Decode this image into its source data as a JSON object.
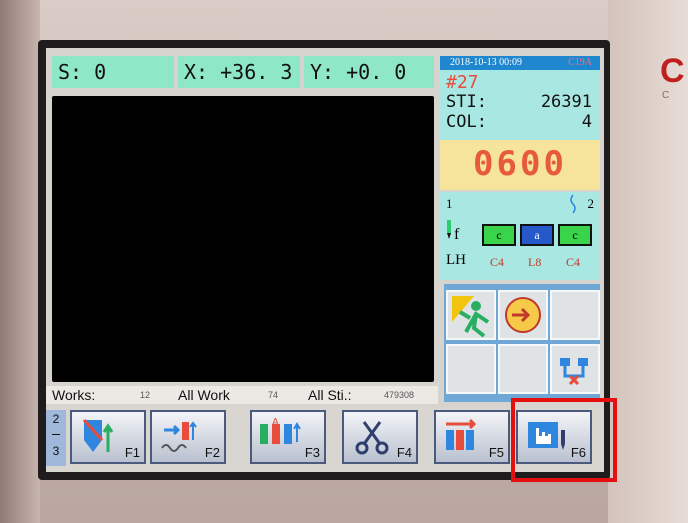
{
  "brand": {
    "mark": "C",
    "sub": "C"
  },
  "coords": {
    "s": "S: 0",
    "x": "X: +36. 3",
    "y": "Y: +0. 0"
  },
  "info": {
    "datetime": "2018-10-13 00:09",
    "code": "C19A",
    "work_num": "#27",
    "sti_label": "STI:",
    "sti_value": "26391",
    "col_label": "COL:",
    "col_value": "4"
  },
  "speed": {
    "value": "0600"
  },
  "needles": {
    "left_num": "1",
    "right_num": "2",
    "f_label": "f",
    "lh_label": "LH",
    "spools": [
      {
        "letter": "c",
        "code": "C4",
        "color": "#39d44a"
      },
      {
        "letter": "a",
        "code": "L8",
        "color": "#2559c9"
      },
      {
        "letter": "c",
        "code": "C4",
        "color": "#39d44a"
      }
    ]
  },
  "status": {
    "works_label": "Works:",
    "works_value": "12",
    "allwork_label": "All Work",
    "allwork_value": "74",
    "allsti_label": "All Sti.:",
    "allsti_value": "479308"
  },
  "page": {
    "current": "2",
    "total": "3"
  },
  "fkeys": [
    "F1",
    "F2",
    "F3",
    "F4",
    "F5",
    "F6"
  ],
  "icons": {
    "grid": [
      "jumping-man-icon",
      "timer-icon",
      "blank-icon",
      "blank-icon",
      "blank-icon",
      "needle-swap-icon"
    ]
  },
  "colors": {
    "accent": "#8ee7c7",
    "highlight": "#e3100f",
    "speed": "#e85a3c"
  }
}
